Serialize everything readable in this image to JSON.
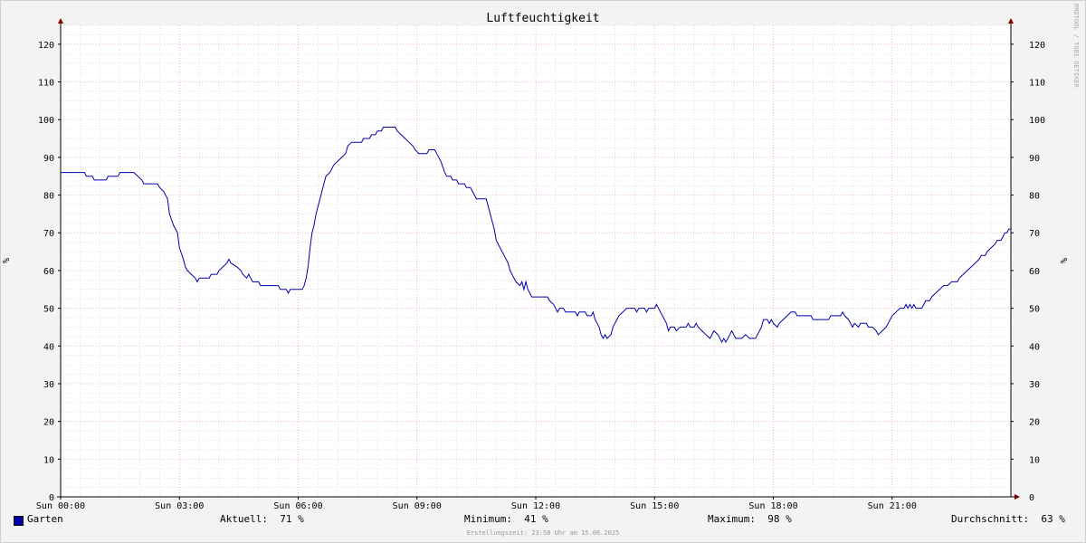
{
  "chart_data": {
    "type": "line",
    "title": "Luftfeuchtigkeit",
    "ylabel": "%",
    "ylim": [
      0,
      125
    ],
    "yticks": [
      0,
      10,
      20,
      30,
      40,
      50,
      60,
      70,
      80,
      90,
      100,
      110,
      120
    ],
    "xlim": [
      0,
      24
    ],
    "xticks": [
      {
        "hour": 0,
        "label": "Sun 00:00"
      },
      {
        "hour": 3,
        "label": "Sun 03:00"
      },
      {
        "hour": 6,
        "label": "Sun 06:00"
      },
      {
        "hour": 9,
        "label": "Sun 09:00"
      },
      {
        "hour": 12,
        "label": "Sun 12:00"
      },
      {
        "hour": 15,
        "label": "Sun 15:00"
      },
      {
        "hour": 18,
        "label": "Sun 18:00"
      },
      {
        "hour": 21,
        "label": "Sun 21:00"
      }
    ],
    "grid": true,
    "series": [
      {
        "name": "Garten",
        "color": "#0000a8",
        "points": [
          [
            0.0,
            86
          ],
          [
            0.6,
            86
          ],
          [
            0.65,
            85
          ],
          [
            0.8,
            85
          ],
          [
            0.85,
            84
          ],
          [
            1.15,
            84
          ],
          [
            1.2,
            85
          ],
          [
            1.45,
            85
          ],
          [
            1.5,
            86
          ],
          [
            1.85,
            86
          ],
          [
            1.95,
            85
          ],
          [
            2.05,
            84
          ],
          [
            2.1,
            83
          ],
          [
            2.45,
            83
          ],
          [
            2.5,
            82
          ],
          [
            2.6,
            81
          ],
          [
            2.7,
            79
          ],
          [
            2.75,
            75
          ],
          [
            2.85,
            72
          ],
          [
            2.95,
            70
          ],
          [
            3.0,
            66
          ],
          [
            3.1,
            63
          ],
          [
            3.15,
            61
          ],
          [
            3.2,
            60
          ],
          [
            3.3,
            59
          ],
          [
            3.4,
            58
          ],
          [
            3.45,
            57
          ],
          [
            3.5,
            58
          ],
          [
            3.75,
            58
          ],
          [
            3.8,
            59
          ],
          [
            3.95,
            59
          ],
          [
            4.0,
            60
          ],
          [
            4.1,
            61
          ],
          [
            4.2,
            62
          ],
          [
            4.25,
            63
          ],
          [
            4.3,
            62
          ],
          [
            4.45,
            61
          ],
          [
            4.55,
            60
          ],
          [
            4.6,
            59
          ],
          [
            4.7,
            58
          ],
          [
            4.75,
            59
          ],
          [
            4.8,
            58
          ],
          [
            4.85,
            57
          ],
          [
            5.0,
            57
          ],
          [
            5.05,
            56
          ],
          [
            5.5,
            56
          ],
          [
            5.55,
            55
          ],
          [
            5.7,
            55
          ],
          [
            5.75,
            54
          ],
          [
            5.8,
            55
          ],
          [
            6.1,
            55
          ],
          [
            6.15,
            56
          ],
          [
            6.2,
            58
          ],
          [
            6.25,
            61
          ],
          [
            6.3,
            66
          ],
          [
            6.35,
            70
          ],
          [
            6.4,
            72
          ],
          [
            6.45,
            75
          ],
          [
            6.5,
            77
          ],
          [
            6.55,
            79
          ],
          [
            6.6,
            81
          ],
          [
            6.65,
            83
          ],
          [
            6.7,
            85
          ],
          [
            6.8,
            86
          ],
          [
            6.85,
            87
          ],
          [
            6.9,
            88
          ],
          [
            7.0,
            89
          ],
          [
            7.1,
            90
          ],
          [
            7.2,
            91
          ],
          [
            7.25,
            93
          ],
          [
            7.35,
            94
          ],
          [
            7.6,
            94
          ],
          [
            7.65,
            95
          ],
          [
            7.8,
            95
          ],
          [
            7.85,
            96
          ],
          [
            7.95,
            96
          ],
          [
            8.0,
            97
          ],
          [
            8.1,
            97
          ],
          [
            8.15,
            98
          ],
          [
            8.45,
            98
          ],
          [
            8.5,
            97
          ],
          [
            8.6,
            96
          ],
          [
            8.7,
            95
          ],
          [
            8.8,
            94
          ],
          [
            8.9,
            93
          ],
          [
            8.95,
            92
          ],
          [
            9.05,
            91
          ],
          [
            9.25,
            91
          ],
          [
            9.3,
            92
          ],
          [
            9.45,
            92
          ],
          [
            9.5,
            91
          ],
          [
            9.6,
            89
          ],
          [
            9.7,
            86
          ],
          [
            9.75,
            85
          ],
          [
            9.85,
            85
          ],
          [
            9.9,
            84
          ],
          [
            10.0,
            84
          ],
          [
            10.05,
            83
          ],
          [
            10.2,
            83
          ],
          [
            10.25,
            82
          ],
          [
            10.35,
            82
          ],
          [
            10.4,
            81
          ],
          [
            10.5,
            79
          ],
          [
            10.75,
            79
          ],
          [
            10.8,
            77
          ],
          [
            10.9,
            73
          ],
          [
            10.95,
            71
          ],
          [
            11.0,
            68
          ],
          [
            11.1,
            66
          ],
          [
            11.2,
            64
          ],
          [
            11.3,
            62
          ],
          [
            11.35,
            60
          ],
          [
            11.45,
            58
          ],
          [
            11.5,
            57
          ],
          [
            11.6,
            56
          ],
          [
            11.65,
            57
          ],
          [
            11.7,
            55
          ],
          [
            11.75,
            57
          ],
          [
            11.8,
            55
          ],
          [
            11.85,
            54
          ],
          [
            11.9,
            53
          ],
          [
            12.0,
            53
          ],
          [
            12.05,
            53
          ],
          [
            12.3,
            53
          ],
          [
            12.35,
            52
          ],
          [
            12.45,
            51
          ],
          [
            12.5,
            50
          ],
          [
            12.55,
            49
          ],
          [
            12.6,
            50
          ],
          [
            12.7,
            50
          ],
          [
            12.75,
            49
          ],
          [
            13.0,
            49
          ],
          [
            13.05,
            48
          ],
          [
            13.1,
            49
          ],
          [
            13.25,
            49
          ],
          [
            13.3,
            48
          ],
          [
            13.4,
            48
          ],
          [
            13.45,
            49
          ],
          [
            13.5,
            47
          ],
          [
            13.6,
            45
          ],
          [
            13.65,
            43
          ],
          [
            13.7,
            42
          ],
          [
            13.75,
            43
          ],
          [
            13.8,
            42
          ],
          [
            13.9,
            43
          ],
          [
            13.95,
            45
          ],
          [
            14.05,
            47
          ],
          [
            14.1,
            48
          ],
          [
            14.2,
            49
          ],
          [
            14.3,
            50
          ],
          [
            14.5,
            50
          ],
          [
            14.55,
            49
          ],
          [
            14.6,
            50
          ],
          [
            14.75,
            50
          ],
          [
            14.8,
            49
          ],
          [
            14.85,
            50
          ],
          [
            15.0,
            50
          ],
          [
            15.05,
            51
          ],
          [
            15.1,
            50
          ],
          [
            15.15,
            49
          ],
          [
            15.2,
            48
          ],
          [
            15.3,
            46
          ],
          [
            15.35,
            44
          ],
          [
            15.4,
            45
          ],
          [
            15.5,
            45
          ],
          [
            15.55,
            44
          ],
          [
            15.65,
            45
          ],
          [
            15.8,
            45
          ],
          [
            15.85,
            46
          ],
          [
            15.9,
            45
          ],
          [
            16.0,
            45
          ],
          [
            16.05,
            46
          ],
          [
            16.1,
            45
          ],
          [
            16.2,
            44
          ],
          [
            16.3,
            43
          ],
          [
            16.4,
            42
          ],
          [
            16.5,
            44
          ],
          [
            16.6,
            43
          ],
          [
            16.7,
            41
          ],
          [
            16.75,
            42
          ],
          [
            16.8,
            41
          ],
          [
            16.9,
            43
          ],
          [
            16.95,
            44
          ],
          [
            17.0,
            43
          ],
          [
            17.05,
            42
          ],
          [
            17.2,
            42
          ],
          [
            17.3,
            43
          ],
          [
            17.4,
            42
          ],
          [
            17.55,
            42
          ],
          [
            17.6,
            43
          ],
          [
            17.7,
            45
          ],
          [
            17.75,
            47
          ],
          [
            17.85,
            47
          ],
          [
            17.9,
            46
          ],
          [
            17.95,
            47
          ],
          [
            18.0,
            46
          ],
          [
            18.1,
            45
          ],
          [
            18.15,
            46
          ],
          [
            18.25,
            47
          ],
          [
            18.35,
            48
          ],
          [
            18.45,
            49
          ],
          [
            18.55,
            49
          ],
          [
            18.6,
            48
          ],
          [
            18.95,
            48
          ],
          [
            19.0,
            47
          ],
          [
            19.4,
            47
          ],
          [
            19.45,
            48
          ],
          [
            19.7,
            48
          ],
          [
            19.75,
            49
          ],
          [
            19.8,
            48
          ],
          [
            19.9,
            47
          ],
          [
            19.95,
            46
          ],
          [
            20.0,
            45
          ],
          [
            20.05,
            46
          ],
          [
            20.15,
            45
          ],
          [
            20.2,
            46
          ],
          [
            20.35,
            46
          ],
          [
            20.4,
            45
          ],
          [
            20.5,
            45
          ],
          [
            20.6,
            44
          ],
          [
            20.65,
            43
          ],
          [
            20.75,
            44
          ],
          [
            20.85,
            45
          ],
          [
            20.9,
            46
          ],
          [
            21.0,
            48
          ],
          [
            21.1,
            49
          ],
          [
            21.2,
            50
          ],
          [
            21.3,
            50
          ],
          [
            21.35,
            51
          ],
          [
            21.4,
            50
          ],
          [
            21.45,
            51
          ],
          [
            21.5,
            50
          ],
          [
            21.55,
            51
          ],
          [
            21.6,
            50
          ],
          [
            21.75,
            50
          ],
          [
            21.8,
            51
          ],
          [
            21.85,
            52
          ],
          [
            21.95,
            52
          ],
          [
            22.0,
            53
          ],
          [
            22.1,
            54
          ],
          [
            22.2,
            55
          ],
          [
            22.3,
            56
          ],
          [
            22.4,
            56
          ],
          [
            22.5,
            57
          ],
          [
            22.65,
            57
          ],
          [
            22.7,
            58
          ],
          [
            22.8,
            59
          ],
          [
            22.9,
            60
          ],
          [
            23.0,
            61
          ],
          [
            23.1,
            62
          ],
          [
            23.2,
            63
          ],
          [
            23.25,
            64
          ],
          [
            23.35,
            64
          ],
          [
            23.4,
            65
          ],
          [
            23.5,
            66
          ],
          [
            23.6,
            67
          ],
          [
            23.65,
            68
          ],
          [
            23.75,
            68
          ],
          [
            23.8,
            69
          ],
          [
            23.85,
            70
          ],
          [
            23.9,
            70
          ],
          [
            23.95,
            71
          ],
          [
            24.0,
            71
          ]
        ]
      }
    ]
  },
  "legend": {
    "series_name": "Garten",
    "aktuell_label": "Aktuell:",
    "aktuell_value": "71 %",
    "minimum_label": "Minimum:",
    "minimum_value": "41 %",
    "maximum_label": "Maximum:",
    "maximum_value": "98 %",
    "durchschnitt_label": "Durchschnitt:",
    "durchschnitt_value": "63 %"
  },
  "footer": "Erstellungszeit: 23:58 Uhr am 15.06.2025",
  "watermark": "RRDTOOL / TOBI OETIKER",
  "colors": {
    "line": "#0000a8",
    "major_grid": "#e8a0a0",
    "minor_grid": "#cfcfcf",
    "plot_bg": "#ffffff",
    "page_bg": "#f3f3f3",
    "axis_arrow": "#800000"
  }
}
